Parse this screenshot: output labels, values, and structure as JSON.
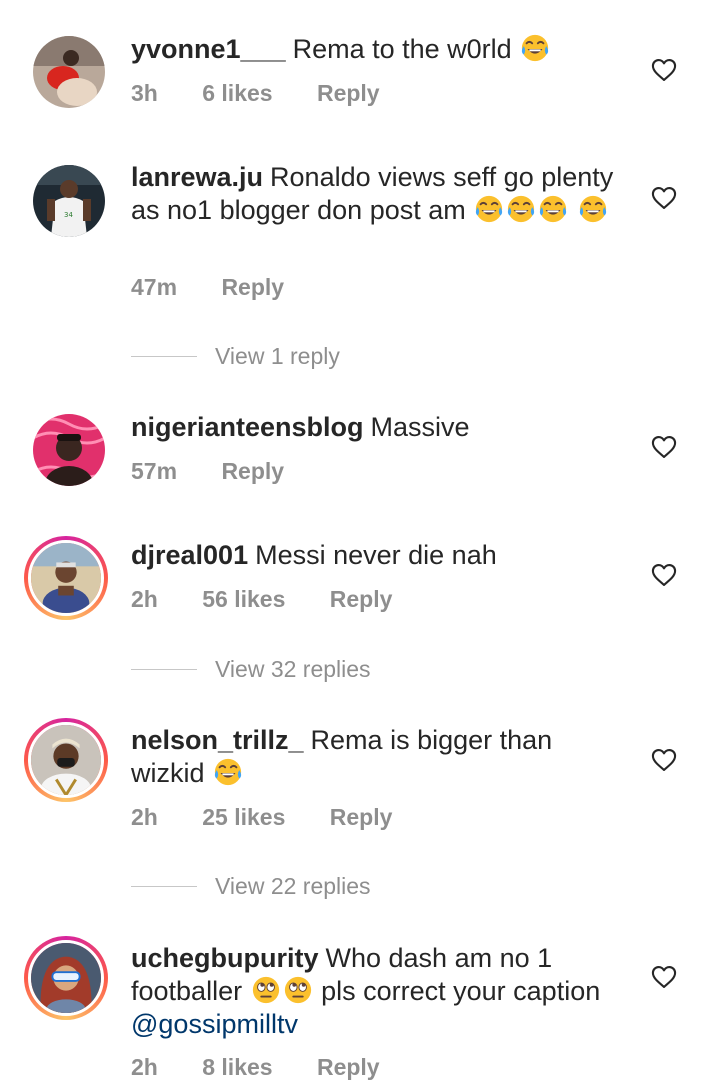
{
  "comments": [
    {
      "username": "yvonne1___",
      "text": "Rema to the w0rld",
      "emojis": [
        "laughing-tears"
      ],
      "time": "3h",
      "likes": "6 likes",
      "reply": "Reply",
      "avatar_ring": false,
      "view_replies": null
    },
    {
      "username": "lanrewa.ju",
      "text": "Ronaldo views seff go plenty as no1 blogger don post am",
      "emojis": [
        "laughing-tears",
        "laughing-tears",
        "laughing-tears",
        "laughing-tears"
      ],
      "time": "47m",
      "likes": "",
      "reply": "Reply",
      "avatar_ring": false,
      "view_replies": "View 1 reply"
    },
    {
      "username": "nigerianteensblog",
      "text": "Massive",
      "emojis": [],
      "time": "57m",
      "likes": "",
      "reply": "Reply",
      "avatar_ring": false,
      "view_replies": null
    },
    {
      "username": "djreal001",
      "text": "Messi never die nah",
      "emojis": [],
      "time": "2h",
      "likes": "56 likes",
      "reply": "Reply",
      "avatar_ring": true,
      "view_replies": "View 32 replies"
    },
    {
      "username": "nelson_trillz_",
      "text": "Rema is bigger than wizkid",
      "emojis": [
        "laughing-tears"
      ],
      "time": "2h",
      "likes": "25 likes",
      "reply": "Reply",
      "avatar_ring": true,
      "view_replies": "View 22 replies"
    },
    {
      "username": "uchegbupurity",
      "text_part1": "Who dash am no 1 footballer",
      "text_part2": "pls correct your caption",
      "mention": "@gossipmilltv",
      "emojis": [
        "eye-roll",
        "eye-roll"
      ],
      "time": "2h",
      "likes": "8 likes",
      "reply": "Reply",
      "avatar_ring": true,
      "view_replies": null
    }
  ],
  "icons": {
    "like": "heart-outline-icon",
    "laugh": "face-with-tears-of-joy",
    "roll": "face-with-rolling-eyes"
  },
  "colors": {
    "text": "#262626",
    "secondary": "#8e8e8e",
    "mention": "#00376b",
    "emoji_yellow": "#fbc02d"
  }
}
